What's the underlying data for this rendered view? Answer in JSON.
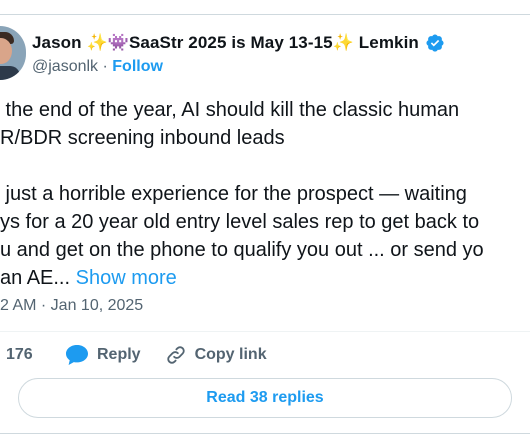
{
  "author": {
    "name": "Jason ✨👾SaaStr 2025 is May 13-15✨ Lemkin",
    "handle": "@jasonlk",
    "separator": "·",
    "follow_label": "Follow"
  },
  "tweet": {
    "line1": " the end of the year, AI should kill the classic human",
    "line2": "R/BDR screening inbound leads",
    "line3": "",
    "line4": " just a horrible experience for the prospect — waiting",
    "line5": "ys for a 20 year old entry level sales rep to get back to",
    "line6": "u and get on the phone to qualify you out ... or send yo",
    "line7": "an AE... ",
    "show_more_label": "Show more"
  },
  "timestamp": "2 AM · Jan 10, 2025",
  "actions": {
    "likes_count": "176",
    "reply_label": "Reply",
    "copy_link_label": "Copy link"
  },
  "read_replies_label": "Read 38 replies",
  "colors": {
    "accent": "#1d9bf0",
    "like": "#f91880",
    "muted": "#536471",
    "border": "#cfd9de"
  }
}
